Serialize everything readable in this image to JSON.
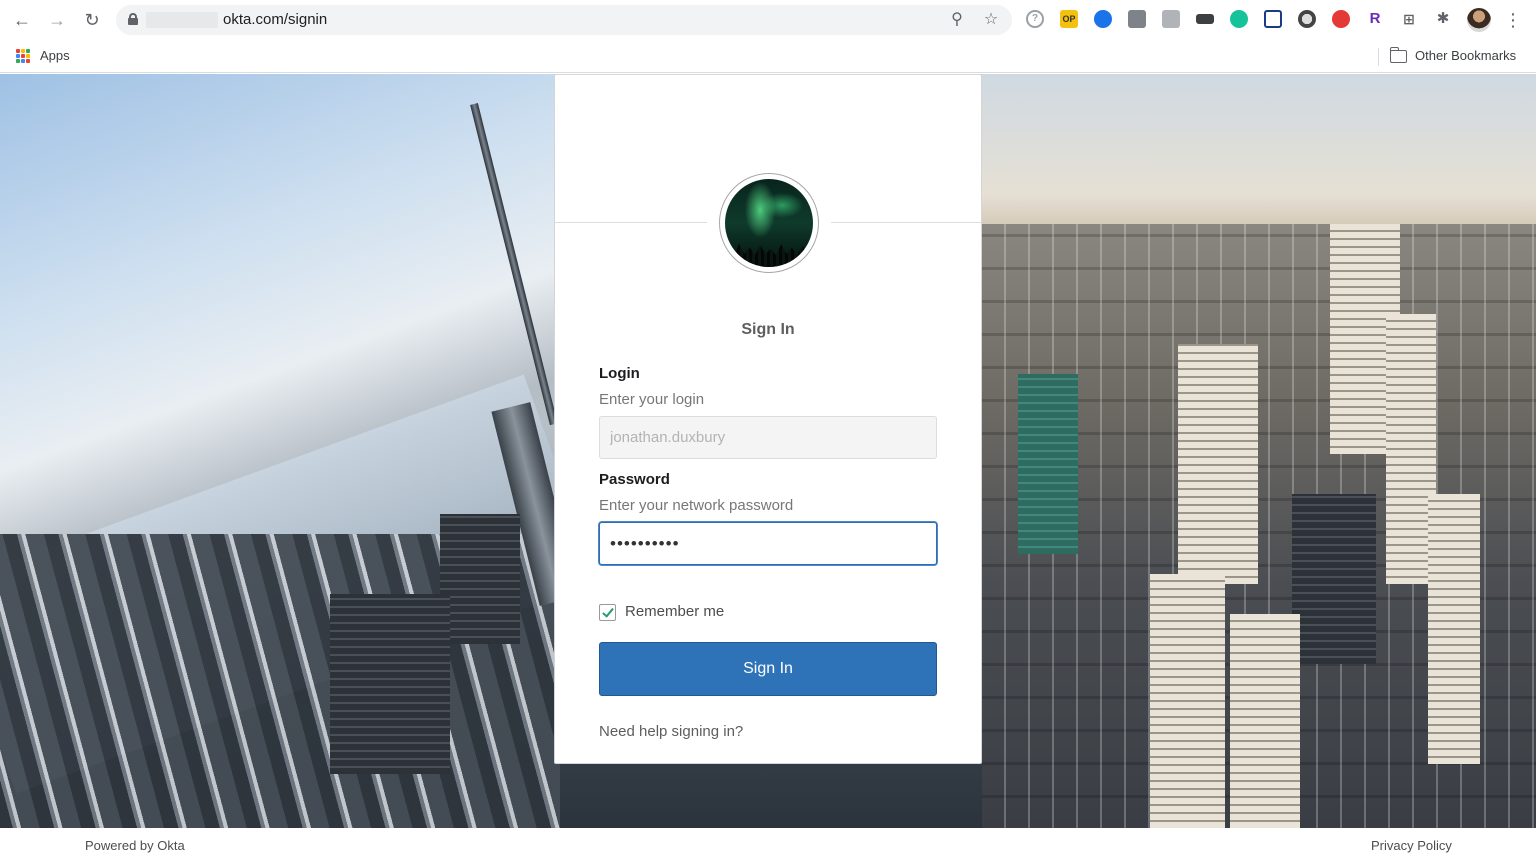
{
  "browser": {
    "url": "okta.com/signin",
    "bookmarks_bar": {
      "apps_label": "Apps",
      "other_bookmarks_label": "Other Bookmarks"
    },
    "extension_badges": {
      "op": "OP",
      "r": "R"
    }
  },
  "signin": {
    "title": "Sign In",
    "login": {
      "label": "Login",
      "hint": "Enter your login",
      "value": "jonathan.duxbury"
    },
    "password": {
      "label": "Password",
      "hint": "Enter your network password",
      "value": "••••••••••"
    },
    "remember_label": "Remember me",
    "remember_checked": true,
    "submit_label": "Sign In",
    "help_link": "Need help signing in?"
  },
  "footer": {
    "powered_by": "Powered by Okta",
    "privacy": "Privacy Policy"
  },
  "colors": {
    "button": "#2e73b8",
    "focus": "#2f6ea9",
    "checkmark": "#2a9c6b"
  }
}
